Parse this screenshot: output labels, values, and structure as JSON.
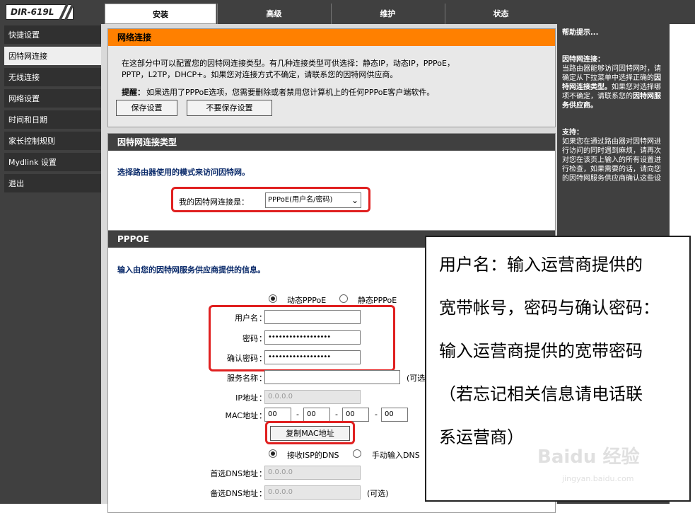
{
  "logo": {
    "text": "DIR-619L"
  },
  "tabs": [
    {
      "label": "安装"
    },
    {
      "label": "高级"
    },
    {
      "label": "维护"
    },
    {
      "label": "状态"
    }
  ],
  "sidebar": {
    "items": [
      {
        "label": "快捷设置"
      },
      {
        "label": "因特网连接"
      },
      {
        "label": "无线连接"
      },
      {
        "label": "网络设置"
      },
      {
        "label": "时间和日期"
      },
      {
        "label": "家长控制规则"
      },
      {
        "label": "Mydlink 设置"
      },
      {
        "label": "退出"
      }
    ]
  },
  "network": {
    "title": "网络连接",
    "desc1": "在这部分中可以配置您的因特网连接类型。有几种连接类型可供选择：静态IP，动态IP，PPPoE，",
    "desc2": "PPTP，L2TP，DHCP+。如果您对连接方式不确定，请联系您的因特网供应商。",
    "note_label": "提醒：",
    "note_text": "如果选用了PPPoE选项，您需要删除或者禁用您计算机上的任何PPPoE客户端软件。",
    "save_label": "保存设置",
    "nosave_label": "不要保存设置"
  },
  "conntype": {
    "title": "因特网连接类型",
    "instruction": "选择路由器使用的模式来访问因特网。",
    "select_label": "我的因特网连接是：",
    "select_value": "PPPoE(用户名/密码)"
  },
  "pppoe": {
    "title": "PPPOE",
    "instruction": "输入由您的因特网服务供应商提供的信息。",
    "dynamic_label": "动态PPPoE",
    "static_label": "静态PPPoE",
    "username_label": "用户名",
    "password_label": "密码",
    "confirm_label": "确认密码",
    "password_value": "••••••••••••••••••",
    "confirm_value": "••••••••••••••••••",
    "service_label": "服务名称",
    "optional_short": "(可选",
    "ip_label": "IP地址",
    "ip_placeholder": "0.0.0.0",
    "mac_label": "MAC地址",
    "mac": [
      "00",
      "00",
      "00",
      "00"
    ],
    "mac_sep": "-",
    "copy_mac_label": "复制MAC地址",
    "dns_auto_label": "接收ISP的DNS",
    "dns_manual_label": "手动输入DNS",
    "dns1_label": "首选DNS地址",
    "dns2_label": "备选DNS地址",
    "dns_placeholder": "0.0.0.0",
    "optional": "(可选)",
    "colon": "："
  },
  "help": {
    "title": "帮助提示...",
    "h1": "因特网连接：",
    "p1a": "当路由器能够访问因特网时，请确定从下拉菜单中选择正确的",
    "p1b": "因特网连接类型。",
    "p1c": "如果您对选择哪项不确定，请联系您的",
    "p1d": "因特网服务供应商。",
    "h2": "支持：",
    "p2": "如果您在通过路由器对因特网进行访问的同时遇到麻烦，请再次对您在该页上输入的所有设置进行检查，如果需要的话，请向您的因特网服务供应商确认这些设"
  },
  "callout": {
    "line1": "用户名：输入运营商提供的",
    "line2": "宽带帐号，密码与确认密码：",
    "line3": "输入运营商提供的宽带密码",
    "line4": "（若忘记相关信息请电话联",
    "line5": "系运营商）"
  },
  "watermark": {
    "text": "Baidu 经验",
    "url": "jingyan.baidu.com"
  }
}
